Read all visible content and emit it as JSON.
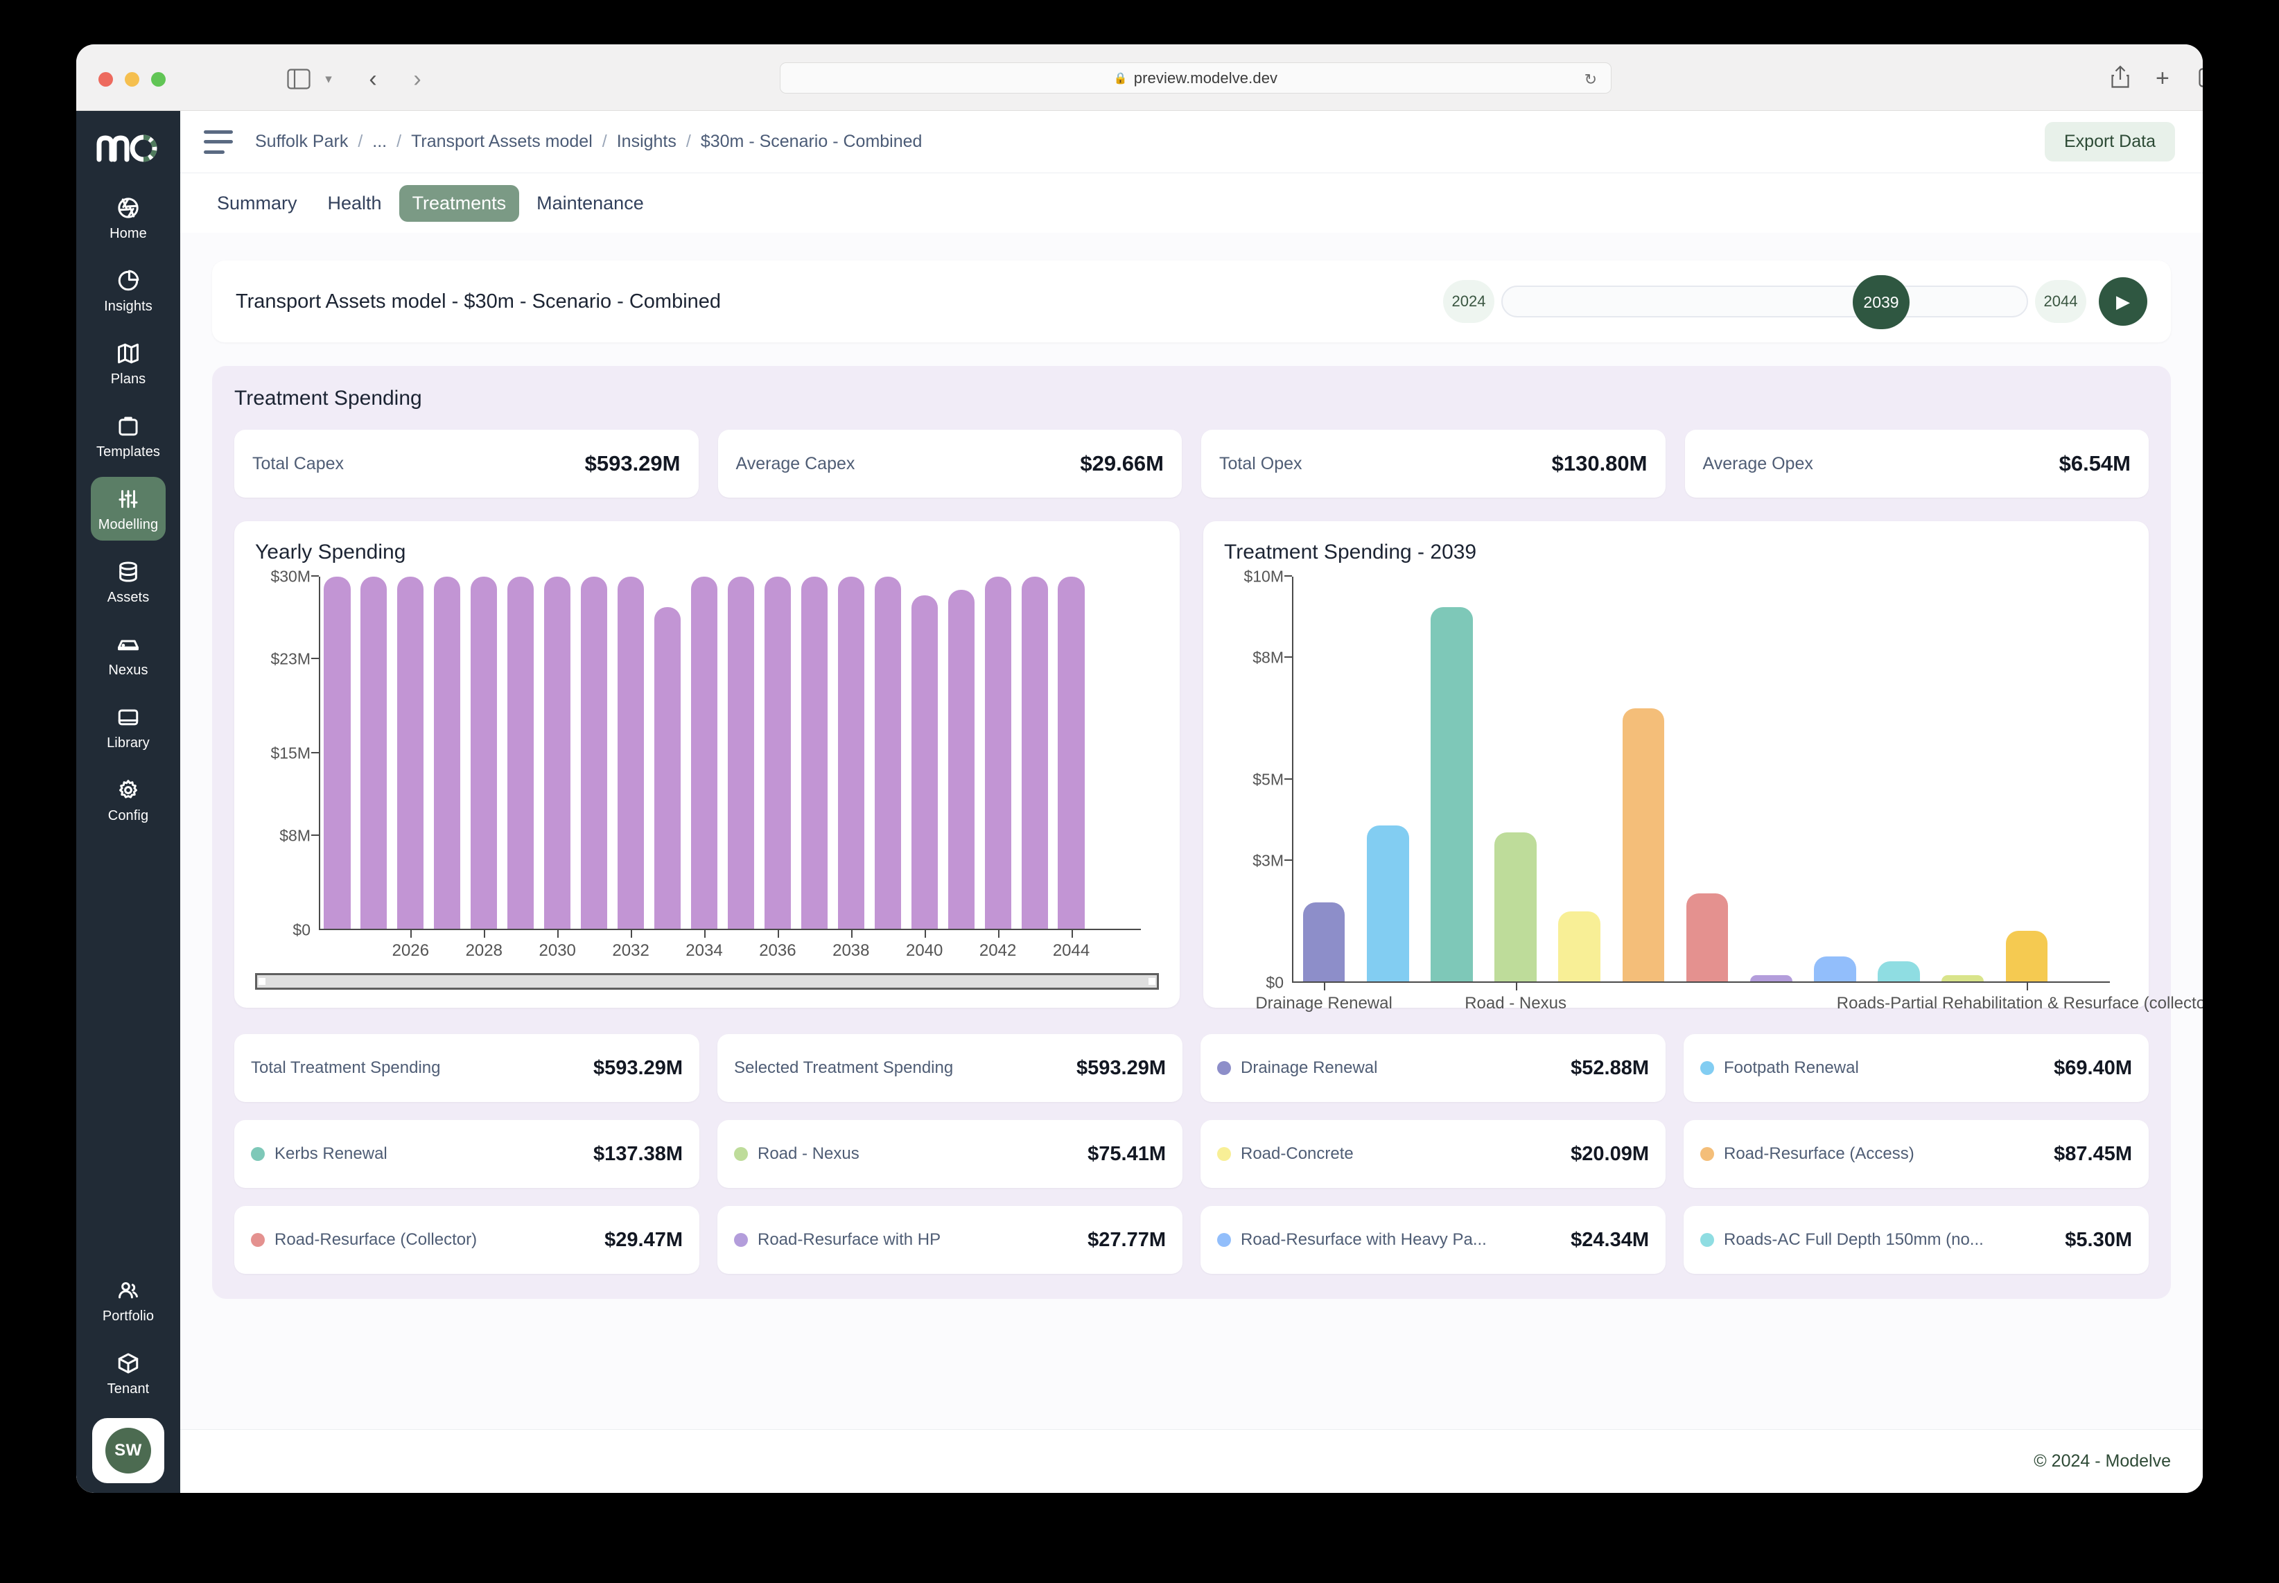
{
  "browser": {
    "url": "preview.modelve.dev",
    "lock_icon": "lock-icon",
    "reload_icon": "reload-icon",
    "back_icon": "chevron-left-icon",
    "forward_icon": "chevron-right-icon",
    "sidebar_icon": "sidebar-toggle-icon",
    "chevron_icon": "chevron-down-icon",
    "share_icon": "share-icon",
    "newtab_icon": "plus-icon",
    "tabs_icon": "tab-overview-icon"
  },
  "rail": {
    "logo": "modelve-logo",
    "items": [
      {
        "label": "Home",
        "icon": "aperture-icon",
        "active": false
      },
      {
        "label": "Insights",
        "icon": "pie-chart-icon",
        "active": false
      },
      {
        "label": "Plans",
        "icon": "map-icon",
        "active": false
      },
      {
        "label": "Templates",
        "icon": "clipboard-icon",
        "active": false
      },
      {
        "label": "Modelling",
        "icon": "sliders-icon",
        "active": true
      },
      {
        "label": "Assets",
        "icon": "database-icon",
        "active": false
      },
      {
        "label": "Nexus",
        "icon": "server-icon",
        "active": false
      },
      {
        "label": "Library",
        "icon": "book-icon",
        "active": false
      },
      {
        "label": "Config",
        "icon": "gear-icon",
        "active": false
      }
    ],
    "bottom_items": [
      {
        "label": "Portfolio",
        "icon": "users-icon"
      },
      {
        "label": "Tenant",
        "icon": "cube-icon"
      }
    ],
    "avatar_initials": "SW"
  },
  "header": {
    "menu_icon": "hamburger-icon",
    "breadcrumb": [
      "Suffolk Park",
      "...",
      "Transport Assets model",
      "Insights",
      "$30m - Scenario - Combined"
    ],
    "breadcrumb_separator": "/",
    "export_label": "Export Data"
  },
  "tabs": [
    {
      "label": "Summary",
      "active": false
    },
    {
      "label": "Health",
      "active": false
    },
    {
      "label": "Treatments",
      "active": true
    },
    {
      "label": "Maintenance",
      "active": false
    }
  ],
  "title_card": {
    "model_title": "Transport Assets model - $30m - Scenario - Combined",
    "year_min": "2024",
    "year_current": "2039",
    "year_max": "2044",
    "play_icon": "play-icon"
  },
  "panel": {
    "title": "Treatment Spending",
    "kpis": [
      {
        "label": "Total Capex",
        "value": "$593.29M"
      },
      {
        "label": "Average Capex",
        "value": "$29.66M"
      },
      {
        "label": "Total Opex",
        "value": "$130.80M"
      },
      {
        "label": "Average Opex",
        "value": "$6.54M"
      }
    ]
  },
  "legend_cards": [
    {
      "name": "Total Treatment Spending",
      "value": "$593.29M",
      "color": null
    },
    {
      "name": "Selected Treatment Spending",
      "value": "$593.29M",
      "color": null
    },
    {
      "name": "Drainage Renewal",
      "value": "$52.88M",
      "color": "#8d8ec9"
    },
    {
      "name": "Footpath Renewal",
      "value": "$69.40M",
      "color": "#82cdf2"
    },
    {
      "name": "Kerbs Renewal",
      "value": "$137.38M",
      "color": "#7ec8b8"
    },
    {
      "name": "Road - Nexus",
      "value": "$75.41M",
      "color": "#bedc9a"
    },
    {
      "name": "Road-Concrete",
      "value": "$20.09M",
      "color": "#f8ef96"
    },
    {
      "name": "Road-Resurface (Access)",
      "value": "$87.45M",
      "color": "#f4be79"
    },
    {
      "name": "Road-Resurface (Collector)",
      "value": "$29.47M",
      "color": "#e4918f"
    },
    {
      "name": "Road-Resurface with HP",
      "value": "$27.77M",
      "color": "#b39ddb"
    },
    {
      "name": "Road-Resurface with Heavy Pa...",
      "value": "$24.34M",
      "color": "#92befb"
    },
    {
      "name": "Roads-AC Full Depth 150mm (no...",
      "value": "$5.30M",
      "color": "#8fdde2"
    }
  ],
  "footer": {
    "copyright": "© 2024 - Modelve"
  },
  "chart_data": [
    {
      "type": "bar",
      "title": "Yearly Spending",
      "xlabel": "",
      "ylabel": "",
      "ylim": [
        0,
        30
      ],
      "ytick_labels": [
        "$0",
        "$8M",
        "$15M",
        "$23M",
        "$30M"
      ],
      "ytick_values": [
        0,
        8,
        15,
        23,
        30
      ],
      "grid": false,
      "legend": "none",
      "bar_color": "#c295d4",
      "categories": [
        "2024",
        "2025",
        "2026",
        "2027",
        "2028",
        "2029",
        "2030",
        "2031",
        "2032",
        "2033",
        "2034",
        "2035",
        "2036",
        "2037",
        "2038",
        "2039",
        "2040",
        "2041",
        "2042",
        "2043",
        "2044"
      ],
      "xtick_labels": [
        "2026",
        "2028",
        "2030",
        "2032",
        "2034",
        "2036",
        "2038",
        "2040",
        "2042",
        "2044"
      ],
      "values": [
        30,
        30,
        30,
        30,
        30,
        30,
        30,
        30,
        30,
        27.4,
        30,
        30,
        30,
        30,
        30,
        30,
        28.4,
        28.9,
        30,
        30,
        30
      ],
      "scrollbar": true
    },
    {
      "type": "bar",
      "title": "Treatment Spending - 2039",
      "xlabel": "",
      "ylabel": "",
      "ylim": [
        0,
        10
      ],
      "ytick_labels": [
        "$0",
        "$3M",
        "$5M",
        "$8M",
        "$10M"
      ],
      "ytick_values": [
        0,
        3,
        5,
        8,
        10
      ],
      "grid": false,
      "legend": "none",
      "xtick_labels": [
        "Drainage Renewal",
        "Road - Nexus",
        "Roads-Partial Rehabilitation & Resurface (collector)"
      ],
      "categories": [
        "Drainage Renewal",
        "Footpath Renewal",
        "Kerbs Renewal",
        "Road - Nexus",
        "Road-Concrete",
        "Road-Resurface (Access)",
        "Road-Resurface (Collector)",
        "Road-Resurface with HP",
        "Road-Resurface with Heavy Pa...",
        "Roads-AC Full Depth 150mm (no...",
        "Roads-Partial Rehabilitation",
        "Roads-Partial Rehabilitation & Resurface (collector)"
      ],
      "values": [
        1.95,
        3.85,
        9.25,
        3.68,
        1.73,
        6.75,
        2.18,
        0.16,
        0.62,
        0.5,
        0.15,
        1.25
      ],
      "colors": [
        "#8d8ec9",
        "#82cdf2",
        "#7ec8b8",
        "#bedc9a",
        "#f8ef96",
        "#f4be79",
        "#e4918f",
        "#b39ddb",
        "#92befb",
        "#8fdde2",
        "#d9e48b",
        "#f5ca51"
      ]
    }
  ]
}
